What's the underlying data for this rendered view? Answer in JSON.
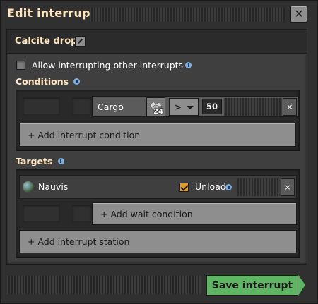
{
  "window": {
    "title": "Edit interrupt",
    "close_icon": "close-icon"
  },
  "interrupt": {
    "name": "Calcite drop",
    "edit_icon": "pencil-icon"
  },
  "allow_interrupting": {
    "label": "Allow interrupting other interrupts",
    "checked": false
  },
  "conditions": {
    "label": "Conditions",
    "rows": [
      {
        "type": "Cargo",
        "item_icon": "calcite-icon",
        "item_count": "24",
        "comparator": ">",
        "value": "50",
        "remove_label": "×"
      }
    ],
    "add_label": "+ Add interrupt condition"
  },
  "targets": {
    "label": "Targets",
    "rows": [
      {
        "name": "Nauvis",
        "icon": "planet-icon",
        "unload_label": "Unload",
        "unload_checked": true,
        "remove_label": "×",
        "add_wait_label": "+ Add wait condition"
      }
    ],
    "add_label": "+ Add interrupt station"
  },
  "footer": {
    "save_label": "Save interrupt"
  },
  "colors": {
    "header_text": "#ffe6c0",
    "button_gray": "#8e8e8e",
    "save_green": "#5eb663",
    "checkbox_orange": "#e49a2a"
  }
}
